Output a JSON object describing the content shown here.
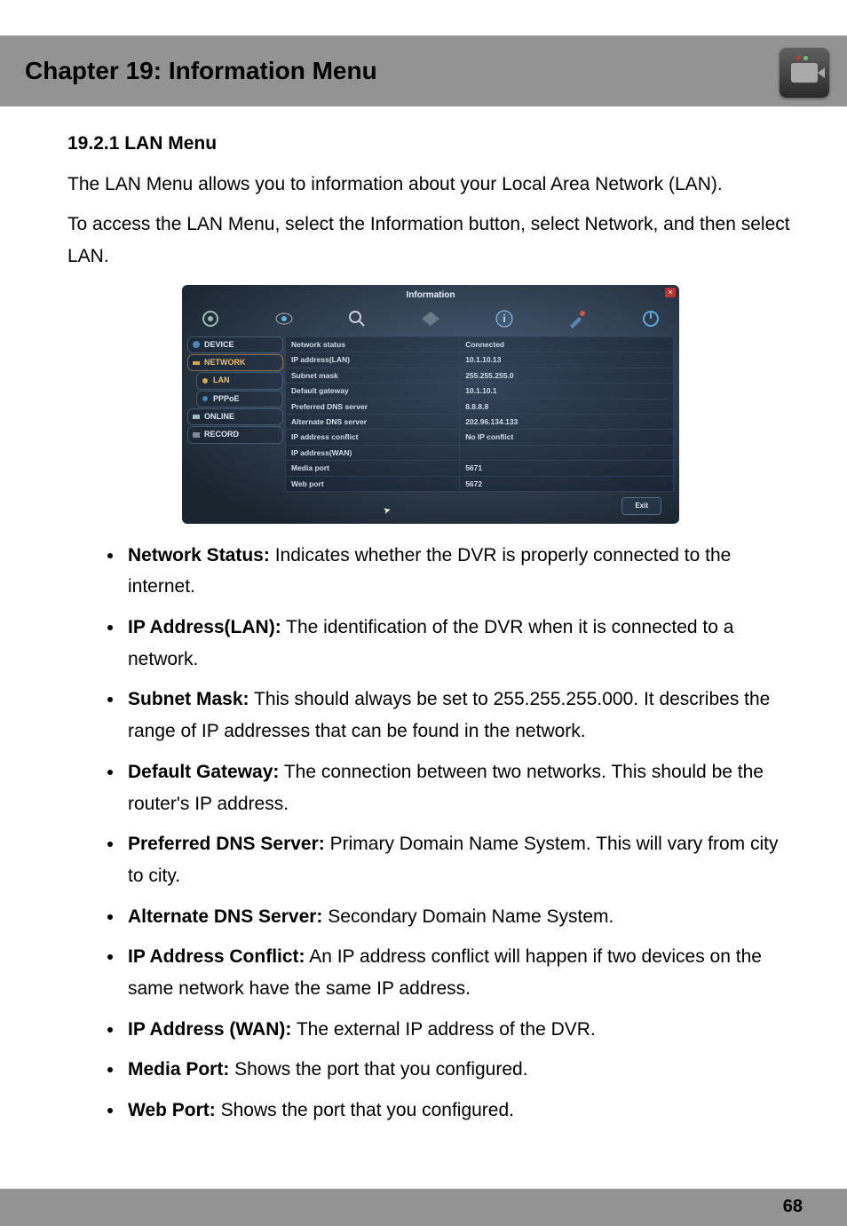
{
  "header": {
    "chapter_title": "Chapter 19: Information Menu"
  },
  "section": {
    "heading": "19.2.1 LAN Menu",
    "intro1": "The LAN Menu allows you to information about your Local Area Network (LAN).",
    "intro2": "To access the LAN Menu, select the Information button, select Network, and then select LAN."
  },
  "screenshot": {
    "window_title": "Information",
    "sidebar": {
      "items": [
        {
          "label": "DEVICE"
        },
        {
          "label": "NETWORK"
        },
        {
          "label": "LAN"
        },
        {
          "label": "PPPoE"
        },
        {
          "label": "ONLINE"
        },
        {
          "label": "RECORD"
        }
      ]
    },
    "rows": [
      {
        "label": "Network status",
        "value": "Connected"
      },
      {
        "label": "IP address(LAN)",
        "value": "10.1.10.13"
      },
      {
        "label": "Subnet mask",
        "value": "255.255.255.0"
      },
      {
        "label": "Default gateway",
        "value": "10.1.10.1"
      },
      {
        "label": "Preferred DNS server",
        "value": "8.8.8.8"
      },
      {
        "label": "Alternate DNS server",
        "value": "202.96.134.133"
      },
      {
        "label": "IP address conflict",
        "value": "No IP conflict"
      },
      {
        "label": "IP address(WAN)",
        "value": ""
      },
      {
        "label": "Media port",
        "value": "5671"
      },
      {
        "label": "Web port",
        "value": "5672"
      }
    ],
    "exit_label": "Exit",
    "close_label": "×"
  },
  "definitions": [
    {
      "term": "Network Status:",
      "desc": " Indicates whether the DVR is properly connected to the internet."
    },
    {
      "term": "IP Address(LAN):",
      "desc": " The identification of the DVR when it is connected to a network."
    },
    {
      "term": "Subnet Mask:",
      "desc": " This should always be set to 255.255.255.000. It describes the range of IP addresses that can be found in the network."
    },
    {
      "term": "Default Gateway:",
      "desc": " The connection between two networks. This should be the router's IP address."
    },
    {
      "term": "Preferred DNS Server:",
      "desc": " Primary Domain Name System. This will vary from city to city."
    },
    {
      "term": "Alternate DNS Server:",
      "desc": " Secondary Domain Name System."
    },
    {
      "term": "IP Address Conflict:",
      "desc": " An IP address conflict will happen if two devices on the same network have the same IP address."
    },
    {
      "term": "IP Address (WAN):",
      "desc": " The external IP address of the DVR."
    },
    {
      "term": "Media Port:",
      "desc": " Shows the port that you configured."
    },
    {
      "term": "Web Port:",
      "desc": " Shows the port that you configured."
    }
  ],
  "footer": {
    "page_number": "68"
  }
}
